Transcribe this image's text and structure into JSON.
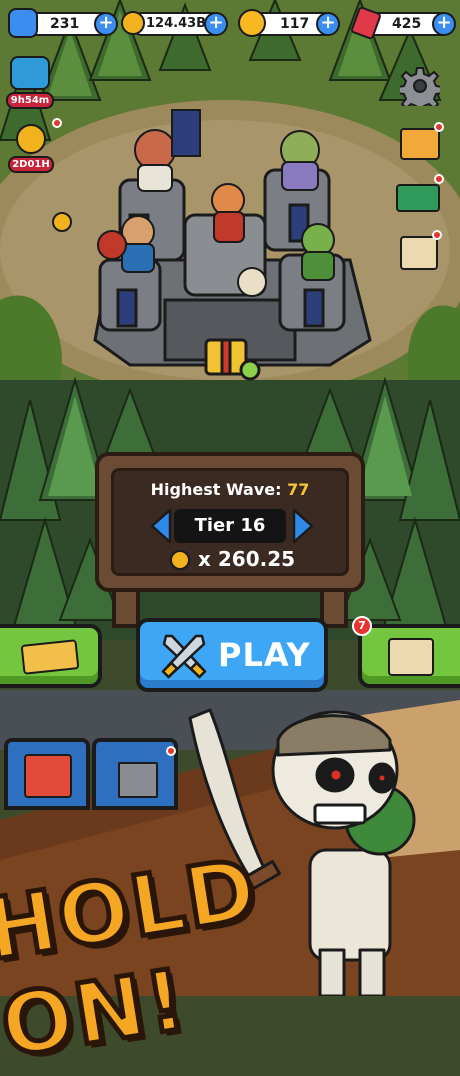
{
  "currencies": {
    "gems": "231",
    "coins": "124.43B",
    "gold": "117",
    "rubies": "425",
    "plus_symbol": "+"
  },
  "left_icons": {
    "chest_timer": "9h54m",
    "trophy_timer": "2D01H"
  },
  "sign": {
    "highest_wave_label": "Highest Wave:",
    "highest_wave_value": "77",
    "tier_label": "Tier 16",
    "multiplier": "x 260.25"
  },
  "play_button": {
    "label": "PLAY"
  },
  "quest_badge_count": "7",
  "banner": {
    "text": "HOLD ON!"
  },
  "colors": {
    "accent_blue": "#3ea7f5",
    "accent_green": "#74c63f",
    "wave_yellow": "#f7c533",
    "banner_orange": "#f5a623"
  }
}
